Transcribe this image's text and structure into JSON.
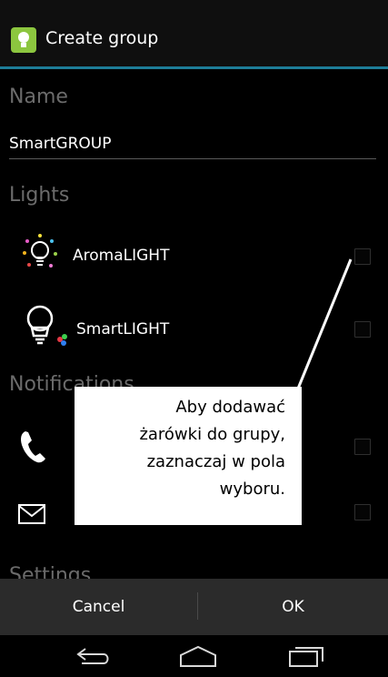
{
  "actionbar": {
    "title": "Create group",
    "icon": "app-bulb-icon"
  },
  "name_section": {
    "label": "Name",
    "value": "SmartGROUP"
  },
  "lights_section": {
    "label": "Lights",
    "items": [
      {
        "label": "AromaLIGHT",
        "icon": "aroma-bulb-icon",
        "checked": false
      },
      {
        "label": "SmartLIGHT",
        "icon": "smart-bulb-icon",
        "checked": false
      }
    ]
  },
  "notifications_section": {
    "label": "Notifications",
    "items": [
      {
        "icon": "phone-icon",
        "checked": false
      },
      {
        "icon": "envelope-icon",
        "checked": false
      }
    ]
  },
  "settings_section": {
    "label": "Settings"
  },
  "callout": {
    "lines": [
      "Aby dodawać",
      "żarówki do grupy,",
      "zaznaczaj w pola",
      "wyboru."
    ]
  },
  "buttons": {
    "cancel": "Cancel",
    "ok": "OK"
  },
  "navbar": {
    "back": "back-icon",
    "home": "home-icon",
    "recents": "recents-icon"
  },
  "colors": {
    "accent": "#1d7d98",
    "section": "#6b6b6b",
    "button_bar": "#2b2b2b"
  }
}
